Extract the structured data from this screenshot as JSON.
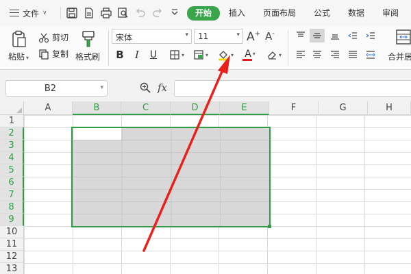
{
  "menu": {
    "file_label": "文件",
    "tabs": [
      {
        "label": "开始",
        "active": true
      },
      {
        "label": "插入",
        "active": false
      },
      {
        "label": "页面布局",
        "active": false
      },
      {
        "label": "公式",
        "active": false
      },
      {
        "label": "数据",
        "active": false
      },
      {
        "label": "审阅",
        "active": false
      }
    ]
  },
  "ribbon": {
    "paste_label": "粘贴",
    "cut_label": "剪切",
    "copy_label": "复制",
    "format_painter_label": "格式刷",
    "font_name": "宋体",
    "font_size": "11",
    "bold_label": "B",
    "italic_label": "I",
    "underline_label": "U",
    "font_color_label": "A",
    "merge_label": "合并居",
    "fill_color": "#ffd800",
    "font_color": "#e02020"
  },
  "formula_bar": {
    "name_box": "B2",
    "fx_label": "fx",
    "formula_value": ""
  },
  "sheet": {
    "columns": [
      "A",
      "B",
      "C",
      "D",
      "E",
      "F",
      "G",
      "H"
    ],
    "rows": [
      "1",
      "2",
      "3",
      "4",
      "5",
      "6",
      "7",
      "8",
      "9",
      "10",
      "11",
      "12",
      "13"
    ],
    "selected_range": "B2:E9",
    "active_cell": "B2",
    "selection_color": "#2f9d45",
    "range_fill_color": "#d8d8d8"
  },
  "annotation": {
    "arrow_color": "#e8211a"
  }
}
